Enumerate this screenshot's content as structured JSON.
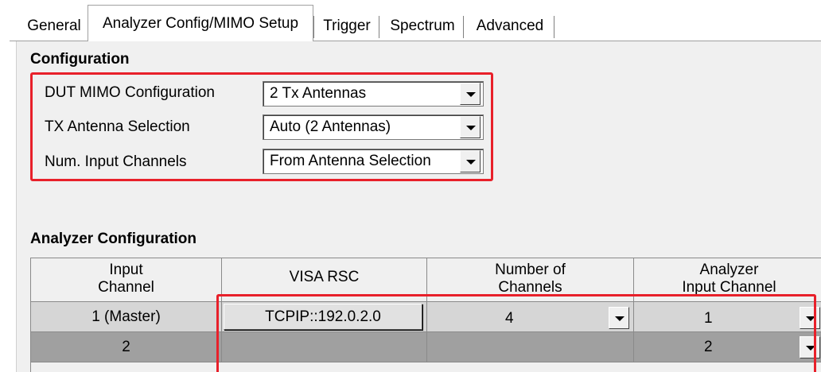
{
  "tabs": [
    {
      "label": "General"
    },
    {
      "label": "Analyzer Config/MIMO Setup"
    },
    {
      "label": "Trigger"
    },
    {
      "label": "Spectrum"
    },
    {
      "label": "Advanced"
    }
  ],
  "configuration": {
    "title": "Configuration",
    "rows": [
      {
        "label": "DUT MIMO Configuration",
        "value": "2 Tx Antennas"
      },
      {
        "label": "TX Antenna Selection",
        "value": "Auto (2 Antennas)"
      },
      {
        "label": "Num. Input Channels",
        "value": "From Antenna Selection"
      }
    ]
  },
  "analyzer": {
    "title": "Analyzer Configuration",
    "columns": [
      {
        "line1": "Input",
        "line2": "Channel"
      },
      {
        "line1": "VISA RSC",
        "line2": ""
      },
      {
        "line1": "Number of",
        "line2": "Channels"
      },
      {
        "line1": "Analyzer",
        "line2": "Input Channel"
      }
    ],
    "rows": [
      {
        "input_channel": "1 (Master)",
        "visa_rsc": "TCPIP::192.0.2.0",
        "num_channels": "4",
        "analyzer_input": "1"
      },
      {
        "input_channel": "2",
        "visa_rsc": "",
        "num_channels": "",
        "analyzer_input": "2"
      }
    ]
  },
  "colors": {
    "highlight": "#e8202a",
    "panel": "#f0f0f0",
    "row_master": "#d6d6d6",
    "row_secondary": "#a0a0a0"
  },
  "icons": {
    "dropdown": "chevron-down-icon"
  }
}
